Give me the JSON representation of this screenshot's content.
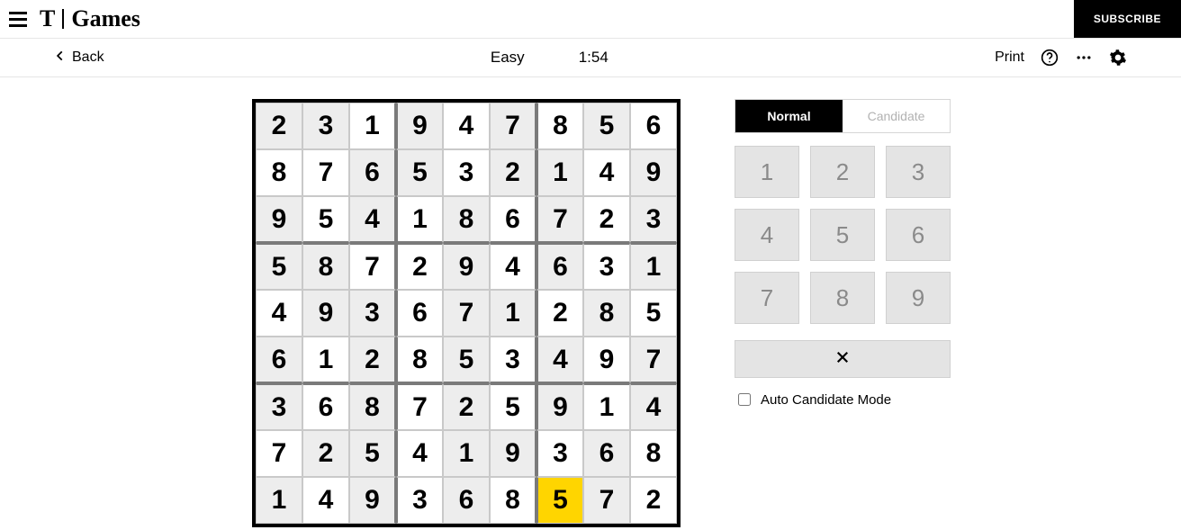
{
  "app": {
    "brand_t": "T",
    "brand_games": "Games",
    "subscribe": "SUBSCRIBE"
  },
  "subbar": {
    "back": "Back",
    "difficulty": "Easy",
    "timer": "1:54",
    "print": "Print"
  },
  "modes": {
    "normal": "Normal",
    "candidate": "Candidate"
  },
  "keypad": {
    "k1": "1",
    "k2": "2",
    "k3": "3",
    "k4": "4",
    "k5": "5",
    "k6": "6",
    "k7": "7",
    "k8": "8",
    "k9": "9"
  },
  "auto_label": "Auto Candidate Mode",
  "board": {
    "rows": [
      [
        {
          "v": "2",
          "g": true
        },
        {
          "v": "3",
          "g": true
        },
        {
          "v": "1",
          "g": false
        },
        {
          "v": "9",
          "g": true
        },
        {
          "v": "4",
          "g": false
        },
        {
          "v": "7",
          "g": true
        },
        {
          "v": "8",
          "g": false
        },
        {
          "v": "5",
          "g": true
        },
        {
          "v": "6",
          "g": false
        }
      ],
      [
        {
          "v": "8",
          "g": false
        },
        {
          "v": "7",
          "g": false
        },
        {
          "v": "6",
          "g": true
        },
        {
          "v": "5",
          "g": true
        },
        {
          "v": "3",
          "g": false
        },
        {
          "v": "2",
          "g": true
        },
        {
          "v": "1",
          "g": true
        },
        {
          "v": "4",
          "g": false
        },
        {
          "v": "9",
          "g": true
        }
      ],
      [
        {
          "v": "9",
          "g": true
        },
        {
          "v": "5",
          "g": false
        },
        {
          "v": "4",
          "g": true
        },
        {
          "v": "1",
          "g": false
        },
        {
          "v": "8",
          "g": true
        },
        {
          "v": "6",
          "g": false
        },
        {
          "v": "7",
          "g": true
        },
        {
          "v": "2",
          "g": false
        },
        {
          "v": "3",
          "g": true
        }
      ],
      [
        {
          "v": "5",
          "g": true
        },
        {
          "v": "8",
          "g": true
        },
        {
          "v": "7",
          "g": false
        },
        {
          "v": "2",
          "g": false
        },
        {
          "v": "9",
          "g": true
        },
        {
          "v": "4",
          "g": false
        },
        {
          "v": "6",
          "g": true
        },
        {
          "v": "3",
          "g": false
        },
        {
          "v": "1",
          "g": true
        }
      ],
      [
        {
          "v": "4",
          "g": false
        },
        {
          "v": "9",
          "g": true
        },
        {
          "v": "3",
          "g": true
        },
        {
          "v": "6",
          "g": false
        },
        {
          "v": "7",
          "g": true
        },
        {
          "v": "1",
          "g": true
        },
        {
          "v": "2",
          "g": false
        },
        {
          "v": "8",
          "g": true
        },
        {
          "v": "5",
          "g": false
        }
      ],
      [
        {
          "v": "6",
          "g": true
        },
        {
          "v": "1",
          "g": false
        },
        {
          "v": "2",
          "g": true
        },
        {
          "v": "8",
          "g": false
        },
        {
          "v": "5",
          "g": true
        },
        {
          "v": "3",
          "g": false
        },
        {
          "v": "4",
          "g": true
        },
        {
          "v": "9",
          "g": false
        },
        {
          "v": "7",
          "g": true
        }
      ],
      [
        {
          "v": "3",
          "g": true
        },
        {
          "v": "6",
          "g": false
        },
        {
          "v": "8",
          "g": true
        },
        {
          "v": "7",
          "g": false
        },
        {
          "v": "2",
          "g": true
        },
        {
          "v": "5",
          "g": false
        },
        {
          "v": "9",
          "g": true
        },
        {
          "v": "1",
          "g": false
        },
        {
          "v": "4",
          "g": true
        }
      ],
      [
        {
          "v": "7",
          "g": false
        },
        {
          "v": "2",
          "g": true
        },
        {
          "v": "5",
          "g": true
        },
        {
          "v": "4",
          "g": false
        },
        {
          "v": "1",
          "g": true
        },
        {
          "v": "9",
          "g": true
        },
        {
          "v": "3",
          "g": false
        },
        {
          "v": "6",
          "g": true
        },
        {
          "v": "8",
          "g": false
        }
      ],
      [
        {
          "v": "1",
          "g": true
        },
        {
          "v": "4",
          "g": false
        },
        {
          "v": "9",
          "g": true
        },
        {
          "v": "3",
          "g": false
        },
        {
          "v": "6",
          "g": true
        },
        {
          "v": "8",
          "g": false
        },
        {
          "v": "5",
          "g": false,
          "sel": true
        },
        {
          "v": "7",
          "g": true
        },
        {
          "v": "2",
          "g": false
        }
      ]
    ]
  }
}
